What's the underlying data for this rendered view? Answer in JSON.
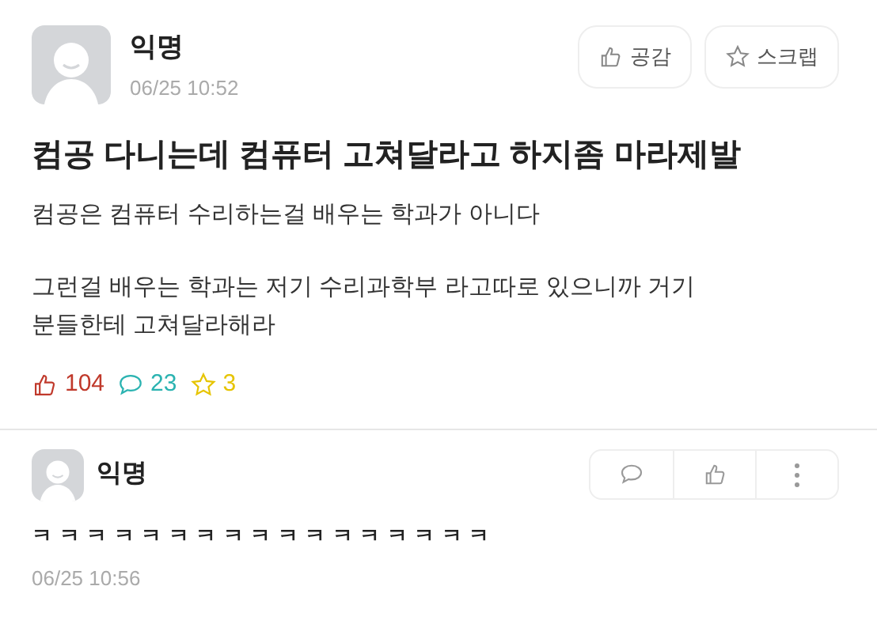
{
  "post": {
    "author": "익명",
    "time": "06/25 10:52",
    "buttons": [
      {
        "kind": "like",
        "label": "공감"
      },
      {
        "kind": "scrap",
        "label": "스크랩"
      }
    ],
    "title": "컴공 다니는데 컴퓨터 고쳐달라고 하지좀 마라제발",
    "paragraphs": [
      "컴공은 컴퓨터 수리하는걸 배우는 학과가 아니다",
      "그런걸 배우는 학과는 저기 수리과학부 라고따로 있으니까 거기 분들한테 고쳐달라해라"
    ],
    "stats": [
      {
        "kind": "like",
        "value": "104",
        "color": "#c0392b"
      },
      {
        "kind": "comment",
        "value": "23",
        "color": "#2bb3b1"
      },
      {
        "kind": "scrap",
        "value": "3",
        "color": "#e6c400"
      }
    ]
  },
  "comment": {
    "author": "익명",
    "text": "ㅋ ㅋ ㅋ ㅋ ㅋ ㅋ ㅋ ㅋ ㅋ ㅋ ㅋ ㅋ ㅋ ㅋ ㅋ ㅋ ㅋ",
    "time": "06/25 10:56",
    "actions": [
      {
        "kind": "reply"
      },
      {
        "kind": "like"
      },
      {
        "kind": "more"
      }
    ]
  }
}
